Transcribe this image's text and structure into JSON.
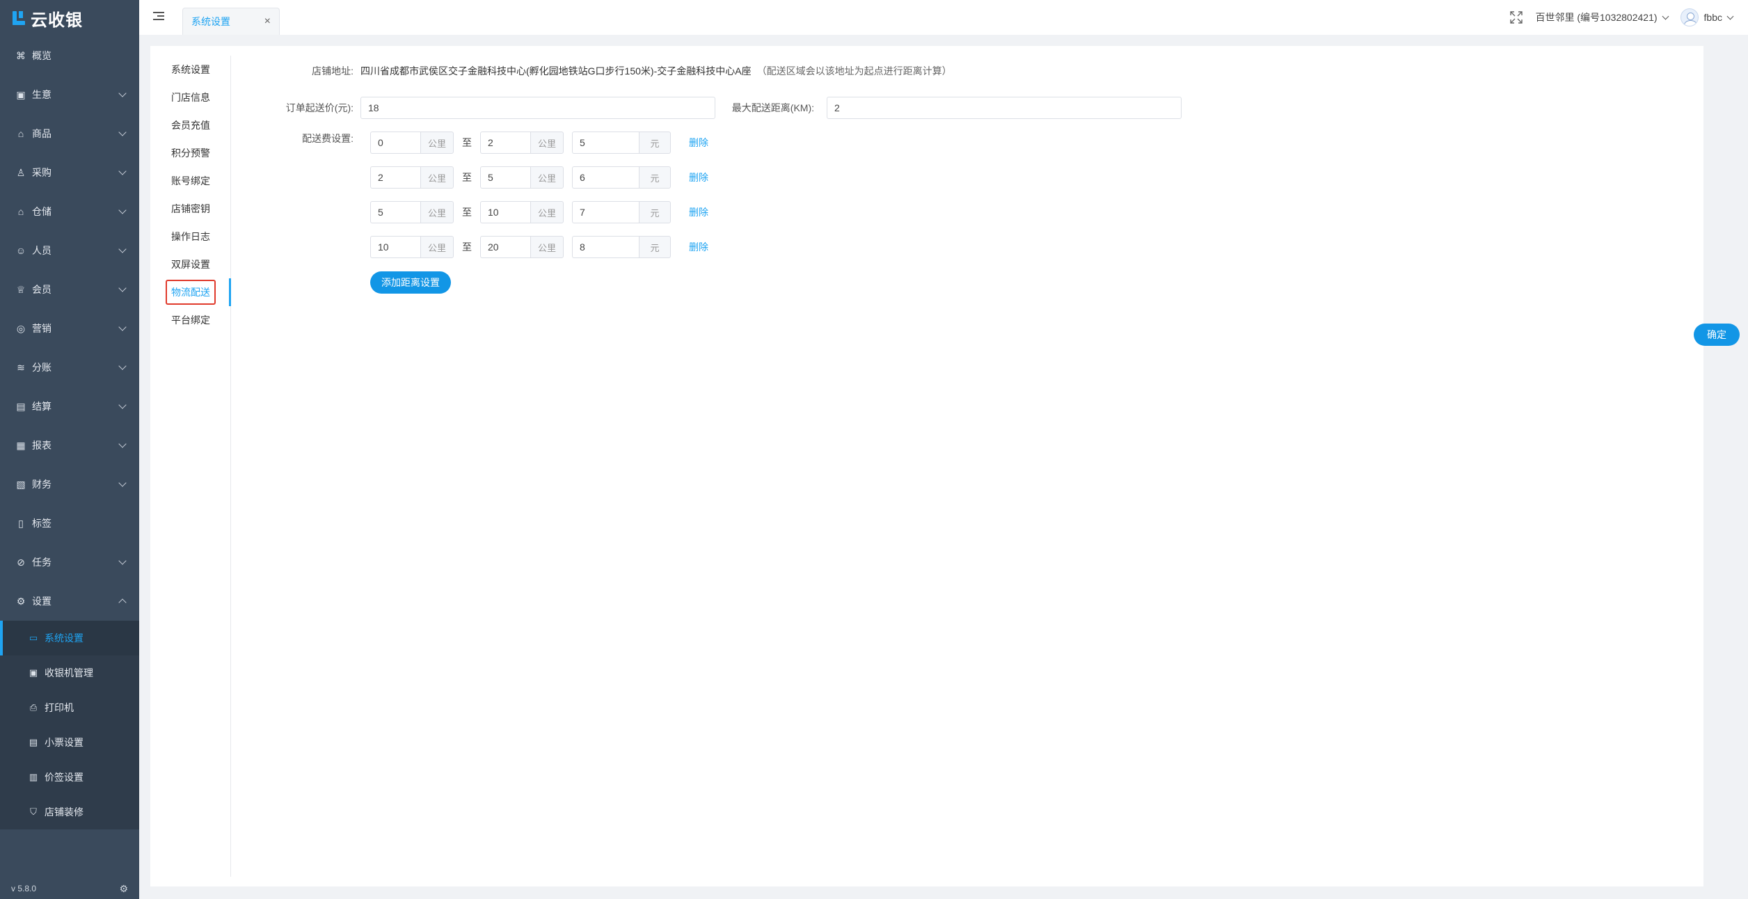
{
  "app": {
    "name": "云收银",
    "version": "v 5.8.0"
  },
  "sidebar": {
    "items": [
      {
        "label": "概览",
        "icon": "dashboard-icon",
        "glyph": "⌘",
        "chevron": false
      },
      {
        "label": "生意",
        "icon": "business-icon",
        "glyph": "▣",
        "chevron": true
      },
      {
        "label": "商品",
        "icon": "goods-icon",
        "glyph": "⌂",
        "chevron": true
      },
      {
        "label": "采购",
        "icon": "purchase-icon",
        "glyph": "♙",
        "chevron": true
      },
      {
        "label": "仓储",
        "icon": "warehouse-icon",
        "glyph": "⌂",
        "chevron": true
      },
      {
        "label": "人员",
        "icon": "staff-icon",
        "glyph": "☺",
        "chevron": true
      },
      {
        "label": "会员",
        "icon": "member-icon",
        "glyph": "♕",
        "chevron": true
      },
      {
        "label": "营销",
        "icon": "marketing-icon",
        "glyph": "◎",
        "chevron": true
      },
      {
        "label": "分账",
        "icon": "split-icon",
        "glyph": "≋",
        "chevron": true
      },
      {
        "label": "结算",
        "icon": "settlement-icon",
        "glyph": "▤",
        "chevron": true
      },
      {
        "label": "报表",
        "icon": "report-icon",
        "glyph": "▦",
        "chevron": true
      },
      {
        "label": "财务",
        "icon": "finance-icon",
        "glyph": "▧",
        "chevron": true
      },
      {
        "label": "标签",
        "icon": "tag-icon",
        "glyph": "▯",
        "chevron": false
      },
      {
        "label": "任务",
        "icon": "task-icon",
        "glyph": "⊘",
        "chevron": true
      },
      {
        "label": "设置",
        "icon": "settings-icon",
        "glyph": "⚙",
        "chevron": true,
        "open": true
      }
    ],
    "sub_items": [
      {
        "label": "系统设置",
        "icon": "monitor-icon",
        "glyph": "▭",
        "active": true
      },
      {
        "label": "收银机管理",
        "icon": "cashier-icon",
        "glyph": "▣",
        "active": false
      },
      {
        "label": "打印机",
        "icon": "printer-icon",
        "glyph": "⎙",
        "active": false
      },
      {
        "label": "小票设置",
        "icon": "receipt-icon",
        "glyph": "▤",
        "active": false
      },
      {
        "label": "价签设置",
        "icon": "price-tag-icon",
        "glyph": "▥",
        "active": false
      },
      {
        "label": "店铺装修",
        "icon": "decorate-icon",
        "glyph": "⛉",
        "active": false
      }
    ]
  },
  "topbar": {
    "tab_label": "系统设置",
    "store": "百世邻里 (编号1032802421)",
    "user": "fbbc"
  },
  "subnav": {
    "items": [
      "系统设置",
      "门店信息",
      "会员充值",
      "积分预警",
      "账号绑定",
      "店铺密钥",
      "操作日志",
      "双屏设置",
      "物流配送",
      "平台绑定"
    ],
    "active_index": 8
  },
  "form": {
    "address_label": "店铺地址:",
    "address_value": "四川省成都市武侯区交子金融科技中心(孵化园地铁站G口步行150米)-交子金融科技中心A座",
    "address_hint": "（配送区域会以该地址为起点进行距离计算）",
    "min_price_label": "订单起送价(元):",
    "min_price_value": "18",
    "max_distance_label": "最大配送距离(KM):",
    "max_distance_value": "2",
    "fee_label": "配送费设置:",
    "unit_km": "公里",
    "unit_yuan": "元",
    "to_text": "至",
    "delete_label": "删除",
    "fee_rows": [
      {
        "from": "0",
        "to": "2",
        "fee": "5"
      },
      {
        "from": "2",
        "to": "5",
        "fee": "6"
      },
      {
        "from": "5",
        "to": "10",
        "fee": "7"
      },
      {
        "from": "10",
        "to": "20",
        "fee": "8"
      }
    ],
    "add_button": "添加距离设置",
    "confirm_button": "确定"
  }
}
